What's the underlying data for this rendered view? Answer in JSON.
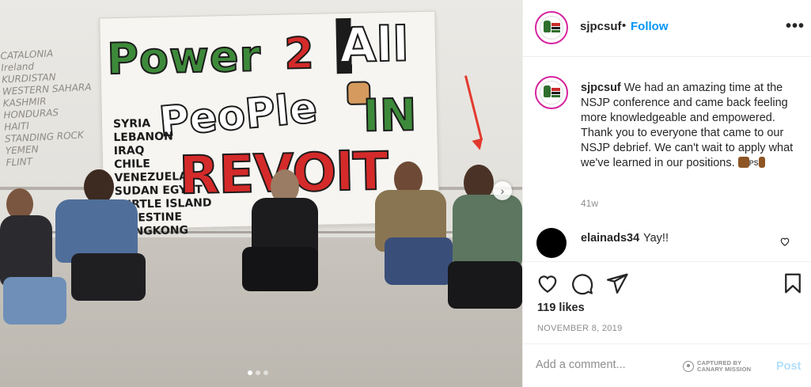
{
  "photo": {
    "whiteboard_lines": [
      "CATALONIA",
      "Ireland",
      "KURDISTAN",
      "WESTERN SAHARA",
      "KASHMIR",
      "HONDURAS",
      "HAITI",
      "STANDING ROCK",
      "YEMEN",
      "FLINT"
    ],
    "banner": {
      "line1": "Power",
      "num": "2",
      "all": "All",
      "people": "PeoPle",
      "in": "IN",
      "revolt": "REVOlT",
      "countries": [
        "SYRIA",
        "LEBANON",
        "IRAQ",
        "CHILE",
        "VENEZUELA",
        "SUDAN EGYPT",
        "TURTLE ISLAND",
        "PALESTINE",
        "HONGKONG"
      ]
    },
    "carousel": {
      "total": 3,
      "active": 1
    }
  },
  "header": {
    "username": "sjpcsuf",
    "separator": "•",
    "follow_label": "Follow",
    "more_label": "•••"
  },
  "caption": {
    "username": "sjpcsuf",
    "text": " We had an amazing time at the NSJP conference and came back feeling more knowledgeable and empowered. Thank you to everyone that came to our NSJP debrief. We can't wait to apply what we've learned in our positions. ",
    "emoji_ps": "PS",
    "age": "41w"
  },
  "comment": {
    "username": "elainads34",
    "text": "Yay!!"
  },
  "actions": {
    "likes": "119 likes",
    "date": "NOVEMBER 8, 2019"
  },
  "comment_bar": {
    "placeholder": "Add a comment...",
    "watermark_line1": "CAPTURED BY",
    "watermark_line2": "CANARY MISSION",
    "post_label": "Post"
  },
  "colors": {
    "link_blue": "#0095f6",
    "post_disabled": "#b2dffc",
    "secondary_text": "#8e8e8e",
    "arrow_red": "#e23a2e"
  }
}
